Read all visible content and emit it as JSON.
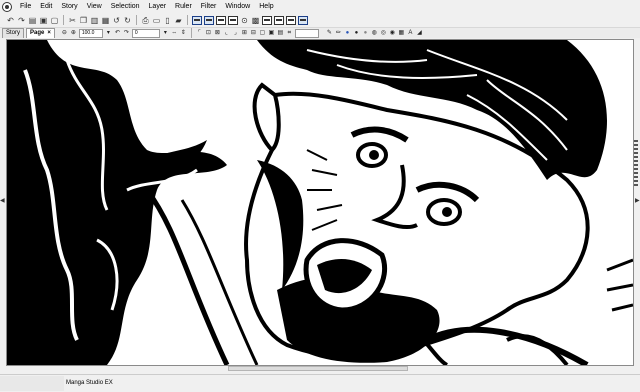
{
  "menubar": {
    "items": [
      "File",
      "Edit",
      "Story",
      "View",
      "Selection",
      "Layer",
      "Ruler",
      "Filter",
      "Window",
      "Help"
    ]
  },
  "tabs": {
    "story": "Story",
    "page": "Page",
    "close": "×"
  },
  "toolbar2": {
    "zoom": "100.0",
    "rotation": "0"
  },
  "statusbar": {
    "app_name": "Manga Studio EX"
  },
  "colors": {
    "chrome_bg": "#f0f0f0",
    "canvas_bg": "#ffffff",
    "ink": "#000000",
    "accent": "#1c3f87"
  }
}
